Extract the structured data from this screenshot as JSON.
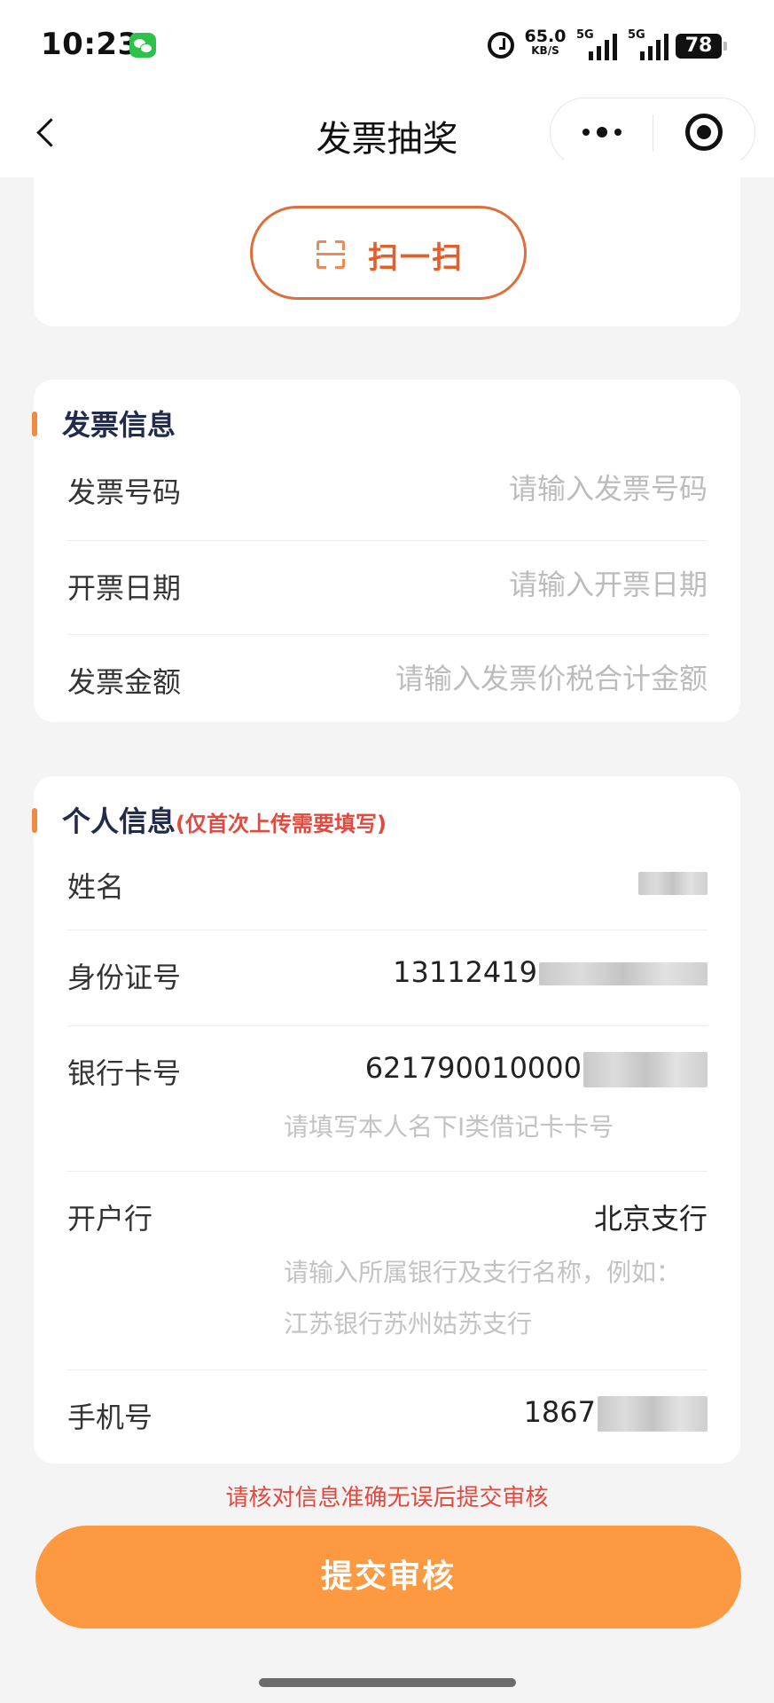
{
  "status_bar": {
    "time": "10:23",
    "speed_value": "65.0",
    "speed_unit": "KB/S",
    "signal1_label": "5G",
    "signal2_label": "5G",
    "battery": "78",
    "icons": [
      "wechat-icon",
      "alarm-icon",
      "signal-icon",
      "battery-icon"
    ]
  },
  "nav": {
    "title": "发票抽奖",
    "back_icon": "chevron-left-icon",
    "more_icon": "more-dots-icon",
    "close_icon": "target-circle-icon"
  },
  "scan": {
    "label": "扫一扫",
    "icon": "scan-icon"
  },
  "invoice": {
    "title": "发票信息",
    "fields": [
      {
        "label": "发票号码",
        "value": "",
        "placeholder": "请输入发票号码"
      },
      {
        "label": "开票日期",
        "value": "",
        "placeholder": "请输入开票日期"
      },
      {
        "label": "发票金额",
        "value": "",
        "placeholder": "请输入发票价税合计金额"
      }
    ]
  },
  "personal": {
    "title": "个人信息",
    "note": "(仅首次上传需要填写)",
    "fields": [
      {
        "label": "姓名",
        "value": ""
      },
      {
        "label": "身份证号",
        "value": "13112419"
      },
      {
        "label": "银行卡号",
        "value": "621790010000",
        "hint": "请填写本人名下I类借记卡卡号"
      },
      {
        "label": "开户行",
        "value": "北京支行",
        "hint_line1": "请输入所属银行及支行名称，例如：",
        "hint_line2": "江苏银行苏州姑苏支行"
      },
      {
        "label": "手机号",
        "value": "1867"
      }
    ]
  },
  "footer": {
    "warning": "请核对信息准确无误后提交审核",
    "submit_label": "提交审核"
  },
  "colors": {
    "accent_orange": "#fd9a41",
    "scan_border": "#e06d3c",
    "warning_red": "#e2493f",
    "section_bar": "#f08a43"
  }
}
